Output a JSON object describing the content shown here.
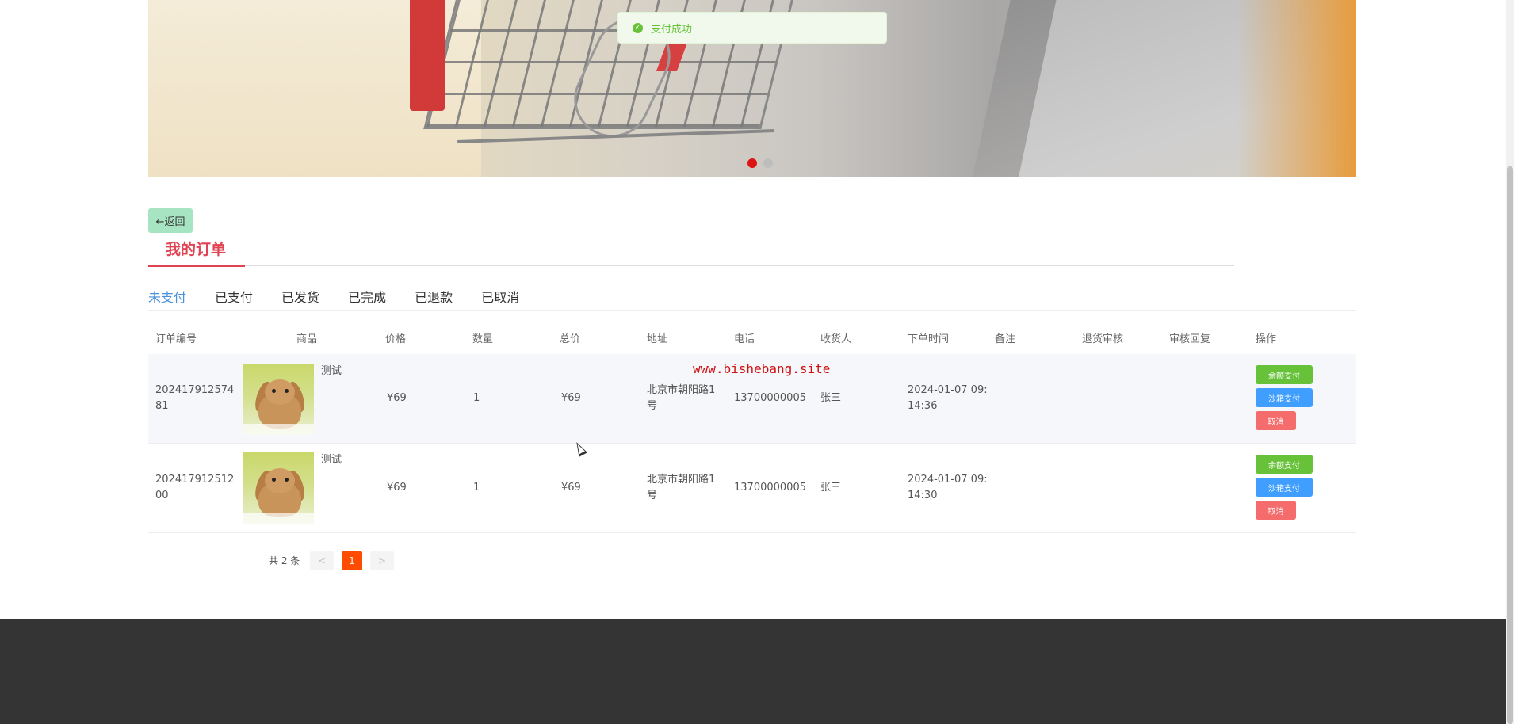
{
  "toast": {
    "message": "支付成功",
    "icon": "check-circle-icon"
  },
  "banner": {
    "slides": 2,
    "active_slide": 1
  },
  "back_button": {
    "label": "←返回"
  },
  "page_title": "我的订单",
  "tabs": [
    {
      "label": "未支付",
      "active": true
    },
    {
      "label": "已支付",
      "active": false
    },
    {
      "label": "已发货",
      "active": false
    },
    {
      "label": "已完成",
      "active": false
    },
    {
      "label": "已退款",
      "active": false
    },
    {
      "label": "已取消",
      "active": false
    }
  ],
  "table": {
    "headers": [
      "订单编号",
      "商品",
      "价格",
      "数量",
      "总价",
      "地址",
      "电话",
      "收货人",
      "下单时间",
      "备注",
      "退货审核",
      "审核回复",
      "操作"
    ],
    "rows": [
      {
        "order_no_line1": "202417912574",
        "order_no_line2": "81",
        "product_name": "测试",
        "price": "¥69",
        "quantity": "1",
        "total": "¥69",
        "address_line1": "北京市朝阳路1",
        "address_line2": "号",
        "phone": "13700000005",
        "receiver": "张三",
        "time_line1": "2024-01-07 09:",
        "time_line2": "14:36",
        "remark": "",
        "return_review": "",
        "review_reply": "",
        "actions": {
          "balance_pay": "余额支付",
          "sandbox_pay": "沙箱支付",
          "cancel": "取消"
        }
      },
      {
        "order_no_line1": "202417912512",
        "order_no_line2": "00",
        "product_name": "测试",
        "price": "¥69",
        "quantity": "1",
        "total": "¥69",
        "address_line1": "北京市朝阳路1",
        "address_line2": "号",
        "phone": "13700000005",
        "receiver": "张三",
        "time_line1": "2024-01-07 09:",
        "time_line2": "14:30",
        "remark": "",
        "return_review": "",
        "review_reply": "",
        "actions": {
          "balance_pay": "余额支付",
          "sandbox_pay": "沙箱支付",
          "cancel": "取消"
        }
      }
    ]
  },
  "watermark": "www.bishebang.site",
  "pagination": {
    "total_text": "共 2 条",
    "prev": "<",
    "current": "1",
    "next": ">"
  },
  "colors": {
    "accent": "#e04352",
    "tab_active": "#4a90d9",
    "success": "#67c23a",
    "primary": "#409eff",
    "danger": "#f56c6c",
    "pager_current": "#ff4c00",
    "footer": "#343434"
  }
}
